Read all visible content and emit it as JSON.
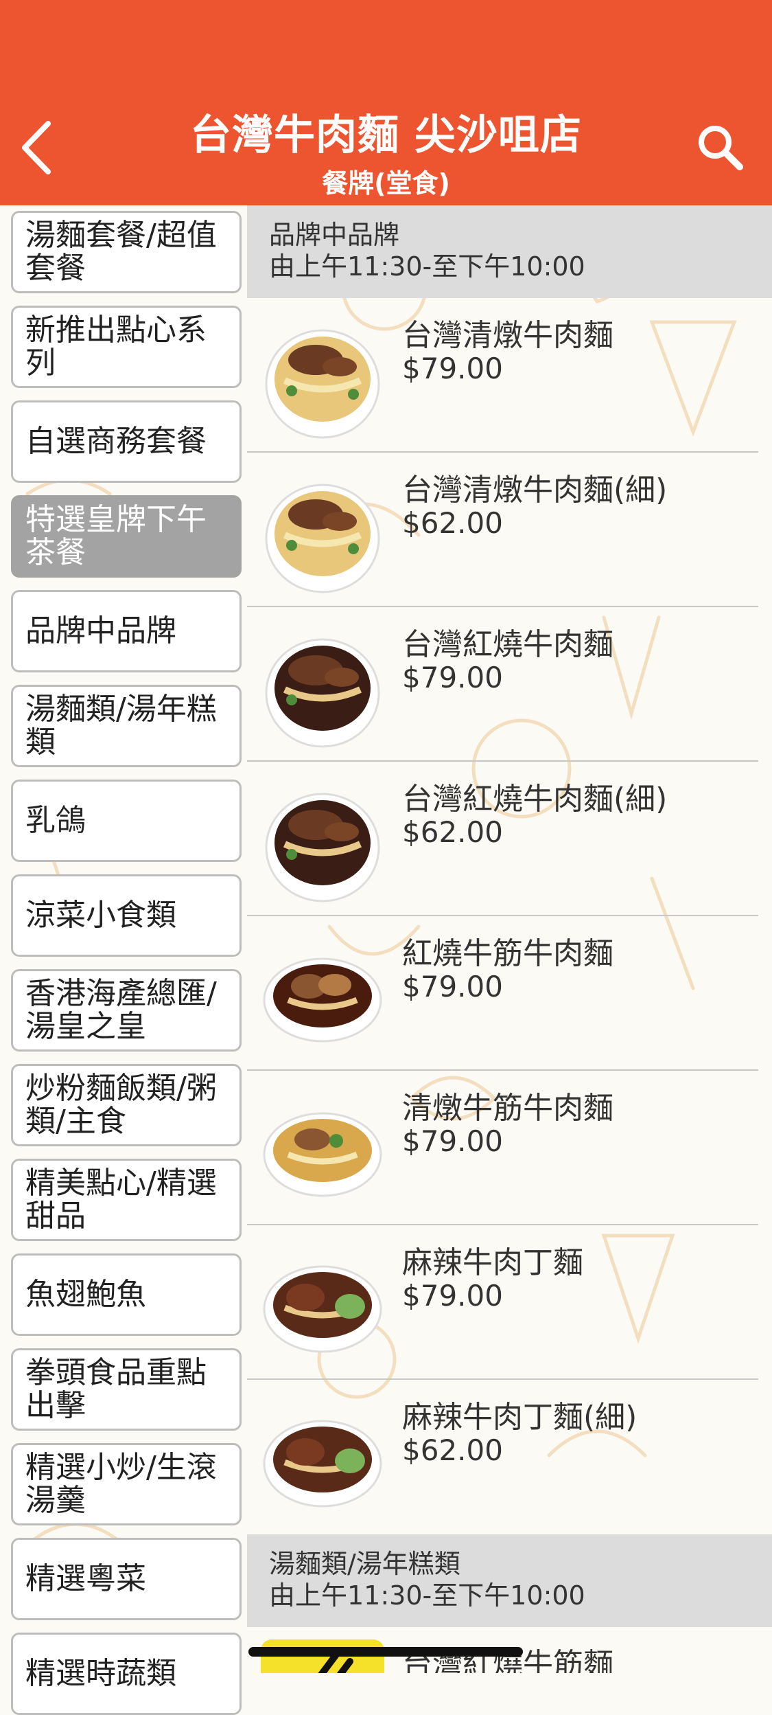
{
  "header": {
    "title": "台灣牛肉麵 尖沙咀店",
    "subtitle": "餐牌(堂食)",
    "background": "#ec5530"
  },
  "sidebar": {
    "active_index": 3,
    "items": [
      {
        "label": "湯麵套餐/超值套餐"
      },
      {
        "label": "新推出點心系列"
      },
      {
        "label": "自選商務套餐"
      },
      {
        "label": "特選皇牌下午茶餐"
      },
      {
        "label": "品牌中品牌"
      },
      {
        "label": "湯麵類/湯年糕類"
      },
      {
        "label": "乳鴿"
      },
      {
        "label": "涼菜小食類"
      },
      {
        "label": "香港海產總匯/湯皇之皇"
      },
      {
        "label": "炒粉麵飯類/粥類/主食"
      },
      {
        "label": "精美點心/精選甜品"
      },
      {
        "label": "魚翅鮑魚"
      },
      {
        "label": "拳頭食品重點出擊"
      },
      {
        "label": "精選小炒/生滾湯羹"
      },
      {
        "label": "精選粵菜"
      },
      {
        "label": "精選時蔬類"
      }
    ]
  },
  "sections": [
    {
      "name": "品牌中品牌",
      "time": "由上午11:30-至下午10:00",
      "items": [
        {
          "name": "台灣清燉牛肉麵",
          "price": "$79.00",
          "icon": "clear-broth-noodle-bowl"
        },
        {
          "name": "台灣清燉牛肉麵(細)",
          "price": "$62.00",
          "icon": "clear-broth-noodle-bowl"
        },
        {
          "name": "台灣紅燒牛肉麵",
          "price": "$79.00",
          "icon": "braised-noodle-bowl"
        },
        {
          "name": "台灣紅燒牛肉麵(細)",
          "price": "$62.00",
          "icon": "braised-noodle-bowl"
        },
        {
          "name": "紅燒牛筋牛肉麵",
          "price": "$79.00",
          "icon": "braised-tendon-noodle-bowl"
        },
        {
          "name": "清燉牛筋牛肉麵",
          "price": "$79.00",
          "icon": "clear-tendon-noodle-bowl"
        },
        {
          "name": "麻辣牛肉丁麵",
          "price": "$79.00",
          "icon": "spicy-noodle-bowl"
        },
        {
          "name": "麻辣牛肉丁麵(細)",
          "price": "$62.00",
          "icon": "spicy-noodle-bowl"
        }
      ]
    },
    {
      "name": "湯麵類/湯年糕類",
      "time": "由上午11:30-至下午10:00",
      "items": [
        {
          "name": "台灣紅燒牛筋麵",
          "price": "",
          "icon": "yellow-placeholder"
        }
      ]
    }
  ]
}
